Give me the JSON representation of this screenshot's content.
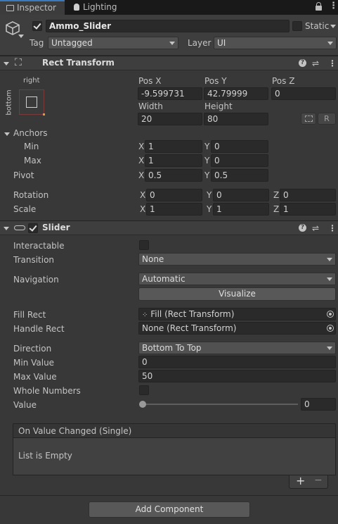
{
  "tabs": {
    "inspector": "Inspector",
    "lighting": "Lighting"
  },
  "object": {
    "name": "Ammo_Slider",
    "static_label": "Static",
    "tag_label": "Tag",
    "tag_value": "Untagged",
    "layer_label": "Layer",
    "layer_value": "UI"
  },
  "rect_transform": {
    "title": "Rect Transform",
    "anchor_h": "right",
    "anchor_v": "bottom",
    "pos_x_label": "Pos X",
    "pos_y_label": "Pos Y",
    "pos_z_label": "Pos Z",
    "pos_x": "-9.599731",
    "pos_y": "42.79999",
    "pos_z": "0",
    "width_label": "Width",
    "height_label": "Height",
    "width": "20",
    "height": "80",
    "r_label": "R",
    "anchors_label": "Anchors",
    "min_label": "Min",
    "min_x": "1",
    "min_y": "0",
    "max_label": "Max",
    "max_x": "1",
    "max_y": "0",
    "pivot_label": "Pivot",
    "pivot_x": "0.5",
    "pivot_y": "0.5",
    "rotation_label": "Rotation",
    "rot_x": "0",
    "rot_y": "0",
    "rot_z": "0",
    "scale_label": "Scale",
    "scale_x": "1",
    "scale_y": "1",
    "scale_z": "1",
    "x": "X",
    "y": "Y",
    "z": "Z"
  },
  "slider": {
    "title": "Slider",
    "interactable_label": "Interactable",
    "transition_label": "Transition",
    "transition_value": "None",
    "navigation_label": "Navigation",
    "navigation_value": "Automatic",
    "visualize_label": "Visualize",
    "fill_rect_label": "Fill Rect",
    "fill_rect_value": "Fill (Rect Transform)",
    "handle_rect_label": "Handle Rect",
    "handle_rect_value": "None (Rect Transform)",
    "direction_label": "Direction",
    "direction_value": "Bottom To Top",
    "min_value_label": "Min Value",
    "min_value": "0",
    "max_value_label": "Max Value",
    "max_value": "50",
    "whole_numbers_label": "Whole Numbers",
    "value_label": "Value",
    "value": "0",
    "event_title": "On Value Changed (Single)",
    "list_empty": "List is Empty",
    "plus": "+",
    "minus": "−"
  },
  "add_component": "Add Component"
}
